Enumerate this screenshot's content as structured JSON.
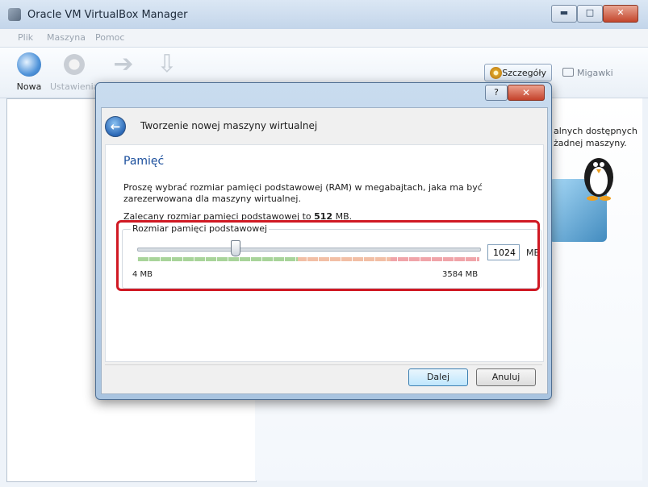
{
  "main_window": {
    "title": "Oracle VM VirtualBox Manager",
    "controls": {
      "minimize": "▬",
      "maximize": "□",
      "close": "✕"
    },
    "menu": [
      "Plik",
      "Maszyna",
      "Pomoc"
    ],
    "toolbar": [
      {
        "label": "Nowa",
        "icon": "new-icon"
      },
      {
        "label": "Ustawienia",
        "icon": "gear-icon"
      },
      {
        "label": "",
        "icon": "start-arrow-icon"
      },
      {
        "label": "",
        "icon": "discard-arrow-icon"
      }
    ],
    "details_button": "Szczegóły",
    "snapshots_button": "Migawki",
    "right_text_line1": "alnych dostępnych",
    "right_text_line2": "żadnej maszyny."
  },
  "dialog": {
    "controls": {
      "help": "?",
      "close": "✕"
    },
    "heading": "Tworzenie nowej maszyny wirtualnej",
    "page_title": "Pamięć",
    "description": "Proszę wybrać rozmiar pamięci podstawowej (RAM) w megabajtach, jaka ma być zarezerwowana dla maszyny wirtualnej.",
    "recommendation_prefix": "Zalecany rozmiar pamięci podstawowej to ",
    "recommendation_value": "512",
    "recommendation_suffix": " MB.",
    "memory": {
      "group_label": "Rozmiar pamięci podstawowej",
      "value": "1024",
      "unit": "MB",
      "min_label": "4 MB",
      "max_label": "3584 MB",
      "slider_min": 4,
      "slider_max": 3584,
      "slider_value": 1024
    },
    "buttons": {
      "next": "Dalej",
      "cancel": "Anuluj"
    }
  },
  "colors": {
    "page_title": "#1a4e9c",
    "highlight_border": "#d01923",
    "slider_green": "#a8d49a",
    "slider_orange": "#f2bfa5",
    "slider_red": "#f0a4a9"
  }
}
